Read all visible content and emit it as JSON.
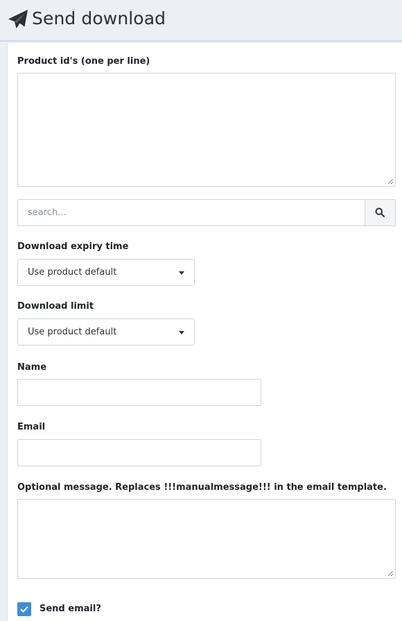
{
  "header": {
    "title": "Send download",
    "icon": "paper-plane-icon"
  },
  "form": {
    "product_ids": {
      "label": "Product id's (one per line)",
      "value": ""
    },
    "search": {
      "placeholder": "search...",
      "icon": "search-icon"
    },
    "expiry": {
      "label": "Download expiry time",
      "selected": "Use product default"
    },
    "limit": {
      "label": "Download limit",
      "selected": "Use product default"
    },
    "name": {
      "label": "Name",
      "value": ""
    },
    "email": {
      "label": "Email",
      "value": ""
    },
    "message": {
      "label": "Optional message. Replaces !!!manualmessage!!! in the email template.",
      "value": ""
    },
    "send_email": {
      "label": "Send email?",
      "checked": true
    }
  },
  "colors": {
    "accent": "#3c8dd9",
    "background": "#eceff4",
    "panel": "#ffffff",
    "border": "#cfd4da"
  }
}
